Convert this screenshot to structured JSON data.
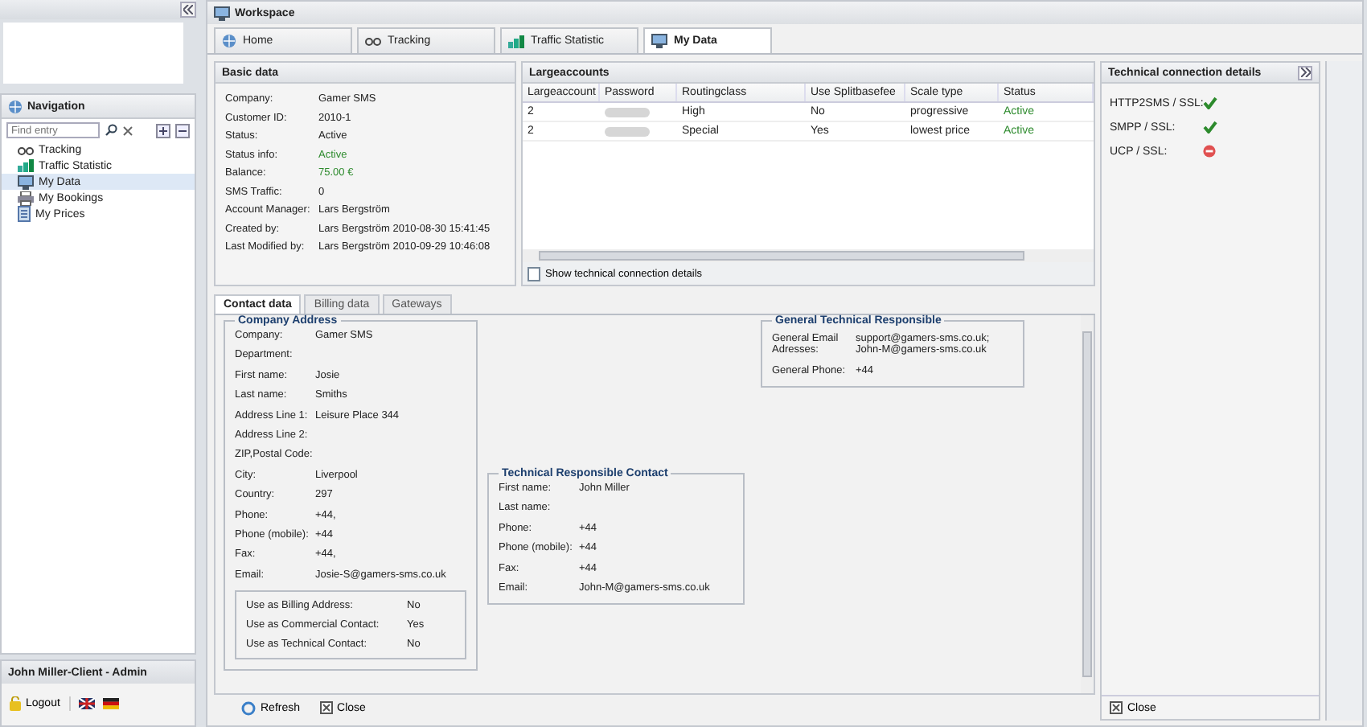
{
  "navigation": {
    "title": "Navigation",
    "search": {
      "placeholder": "Find entry"
    },
    "items": [
      {
        "label": "Tracking",
        "selected": false
      },
      {
        "label": "Traffic Statistic",
        "selected": false
      },
      {
        "label": "My Data",
        "selected": true
      },
      {
        "label": "My Bookings",
        "selected": false
      },
      {
        "label": "My Prices",
        "selected": false
      }
    ]
  },
  "user": {
    "name": "John Miller-Client - Admin",
    "logout": "Logout"
  },
  "workspace": {
    "title": "Workspace",
    "tabs": [
      {
        "label": "Home",
        "selected": false
      },
      {
        "label": "Tracking",
        "selected": false
      },
      {
        "label": "Traffic Statistic",
        "selected": false
      },
      {
        "label": "My Data",
        "selected": true
      }
    ]
  },
  "basic_data": {
    "title": "Basic data",
    "fields": [
      {
        "label": "Company:",
        "value": "Gamer SMS",
        "positive": false
      },
      {
        "label": "Customer ID:",
        "value": "2010-1",
        "positive": false
      },
      {
        "label": "Status:",
        "value": "Active",
        "positive": false
      },
      {
        "label": "Status info:",
        "value": "Active",
        "positive": true
      },
      {
        "label": "Balance:",
        "value": "75.00 €",
        "positive": true
      },
      {
        "label": "SMS Traffic:",
        "value": "0",
        "positive": false
      },
      {
        "label": "Account Manager:",
        "value": "Lars Bergström",
        "positive": false
      },
      {
        "label": "Created by:",
        "value": "Lars Bergström 2010-08-30 15:41:45",
        "positive": false
      },
      {
        "label": "Last Modified by:",
        "value": "Lars Bergström 2010-09-29 10:46:08",
        "positive": false
      }
    ]
  },
  "largeaccounts": {
    "title": "Largeaccounts",
    "columns": [
      "Largeaccount",
      "Password",
      "Routingclass",
      "Use Splitbasefee",
      "Scale type",
      "Status"
    ],
    "rows": [
      {
        "cells": [
          "2",
          "",
          "High",
          "No",
          "progressive",
          "Active"
        ],
        "active": true
      },
      {
        "cells": [
          "2",
          "",
          "Special",
          "Yes",
          "lowest price",
          "Active"
        ],
        "active": true
      }
    ],
    "footer": "Show technical connection details"
  },
  "technical": {
    "title": "Technical connection details",
    "items": [
      {
        "label": "HTTP2SMS / SSL:",
        "ok": true
      },
      {
        "label": "SMPP / SSL:",
        "ok": true
      },
      {
        "label": "UCP / SSL:",
        "ok": false
      }
    ],
    "close": "Close"
  },
  "subtabs": [
    {
      "label": "Contact data",
      "selected": true
    },
    {
      "label": "Billing data",
      "selected": false
    },
    {
      "label": "Gateways",
      "selected": false
    }
  ],
  "company_address": {
    "title": "Company Address",
    "fields": [
      {
        "label": "Company:",
        "value": "Gamer SMS"
      },
      {
        "label": "Department:"
      },
      {
        "label": "First name:",
        "value": "Josie"
      },
      {
        "label": "Last name:",
        "value": "Smiths"
      },
      {
        "label": "Address Line 1:",
        "value": "Leisure Place 344"
      },
      {
        "label": "Address Line 2:"
      },
      {
        "label": "ZIP,Postal Code:"
      },
      {
        "label": "City:",
        "value": "Liverpool"
      },
      {
        "label": "Country:",
        "value": "297"
      },
      {
        "label": "Phone:",
        "value": "+44,"
      },
      {
        "label": "Phone (mobile):",
        "value": "+44"
      },
      {
        "label": "Fax:",
        "value": "+44,"
      },
      {
        "label": "Email:",
        "value": "Josie-S@gamers-sms.co.uk"
      }
    ],
    "usage": [
      {
        "label": "Use as Billing Address:",
        "value": "No"
      },
      {
        "label": "Use as Commercial Contact:",
        "value": "Yes"
      },
      {
        "label": "Use as Technical Contact:",
        "value": "No"
      }
    ]
  },
  "technical_contact": {
    "title": "Technical Responsible Contact",
    "fields": [
      {
        "label": "First name:",
        "value": "John Miller"
      },
      {
        "label": "Last name:"
      },
      {
        "label": "Phone:",
        "value": "+44"
      },
      {
        "label": "Phone (mobile):",
        "value": "+44"
      },
      {
        "label": "Fax:",
        "value": "+44"
      },
      {
        "label": "Email:",
        "value": "John-M@gamers-sms.co.uk"
      }
    ]
  },
  "general_technical": {
    "title": "General Technical Responsible",
    "fields": [
      {
        "label": "General Email Adresses:",
        "value": "support@gamers-sms.co.uk; John-M@gamers-sms.co.uk"
      },
      {
        "label": "General Phone:",
        "value": "+44"
      }
    ]
  },
  "toolbar": {
    "refresh": "Refresh",
    "close": "Close"
  }
}
